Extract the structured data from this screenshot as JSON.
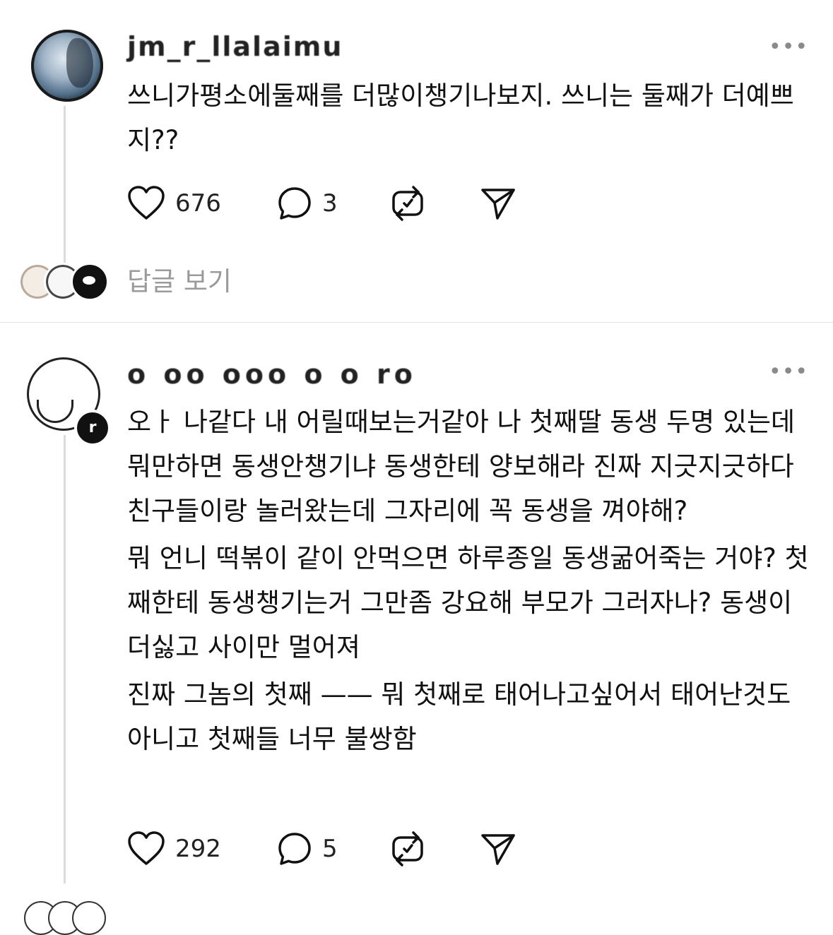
{
  "posts": [
    {
      "username": "jm_r_llalaimu",
      "text_paragraphs": [
        "쓰니가평소에둘째를  더많이챙기나보지. 쓰니는 둘째가 더예쁘지??"
      ],
      "likes": "676",
      "replies": "3",
      "view_replies_label": "답글 보기"
    },
    {
      "username": "o oo ooo o o ro",
      "text_paragraphs": [
        "오ㅏ 나같다 내 어릴때보는거같아 나 첫째딸 동생 두명 있는데 뭐만하면 동생안챙기냐 동생한테 양보해라 진짜 지긋지긋하다  친구들이랑 놀러왔는데 그자리에 꼭 동생을 껴야해?",
        "뭐 언니 떡볶이 같이 안먹으면 하루종일 동생굶어죽는 거야? 첫째한테 동생챙기는거 그만좀 강요해 부모가 그러자나? 동생이 더싫고 사이만 멀어져",
        "진짜 그놈의 첫째 —— 뭐 첫째로 태어나고싶어서 태어난것도아니고 첫째들 너무 불쌍함"
      ],
      "likes": "292",
      "replies": "5"
    }
  ],
  "more_glyph": "•••",
  "badge_glyph": "r",
  "icons": {
    "like": "heart-icon",
    "reply": "comment-icon",
    "repost": "repost-icon",
    "share": "send-icon",
    "more": "more-icon"
  }
}
